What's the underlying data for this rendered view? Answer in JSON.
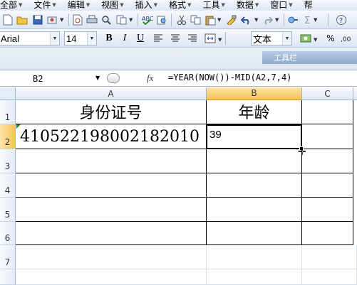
{
  "menu": {
    "items": [
      "全部",
      "文件",
      "编辑",
      "视图",
      "插入",
      "格式",
      "工具",
      "数据",
      "窗口",
      "帮"
    ]
  },
  "format_toolbar": {
    "font_name": "Arial",
    "font_size": "14",
    "bold": "B",
    "italic": "I",
    "underline": "U",
    "number_format": "文本",
    "percent": "%"
  },
  "floating_toolbar": {
    "title": "工具栏"
  },
  "formula_bar": {
    "name_box": "B2",
    "fx_label": "fx",
    "formula": "=YEAR(NOW())-MID(A2,7,4)"
  },
  "sheet": {
    "columns": [
      "A",
      "B",
      "C"
    ],
    "rows": [
      "1",
      "2",
      "3",
      "4",
      "5",
      "6",
      "7"
    ],
    "cells": {
      "A1": "身份证号",
      "B1": "年龄",
      "A2": "410522198002182010",
      "B2": "39"
    },
    "active_cell": "B2"
  },
  "colors": {
    "header_active": "#f8c25c",
    "fill_handle": "#000000",
    "error_triangle": "#1e8a2a"
  }
}
